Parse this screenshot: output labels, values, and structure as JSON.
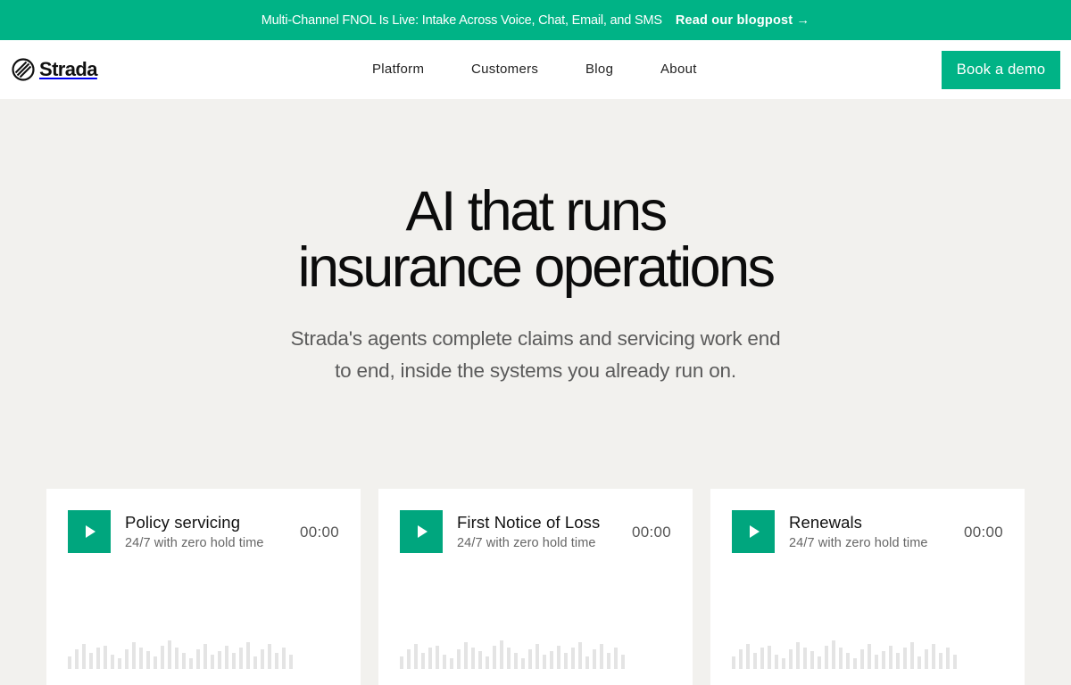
{
  "banner": {
    "text": "Multi-Channel FNOL Is Live: Intake Across Voice, Chat, Email, and SMS",
    "link": "Read our blogpost →"
  },
  "nav": {
    "logo_text": "Strada",
    "logo_icon": "strada-logo-icon",
    "links": [
      "Platform",
      "Customers",
      "Blog",
      "About"
    ],
    "cta": "Book a demo"
  },
  "hero": {
    "title_line1": "AI that runs",
    "title_line2": "insurance operations",
    "subtitle": "Strada's agents complete claims and servicing work end to end, inside the systems you already run on."
  },
  "cards": [
    {
      "title": "Policy servicing",
      "subtitle": "24/7 with zero hold time",
      "time": "00:00",
      "icon": "play-icon"
    },
    {
      "title": "First Notice of Loss",
      "subtitle": "24/7 with zero hold time",
      "time": "00:00",
      "icon": "play-icon"
    },
    {
      "title": "Renewals",
      "subtitle": "24/7 with zero hold time",
      "time": "00:00",
      "icon": "play-icon"
    }
  ],
  "colors": {
    "brand": "#00b386",
    "play": "#00a67e",
    "background": "#f2f1ee",
    "waveform": "#e4e4e4"
  }
}
